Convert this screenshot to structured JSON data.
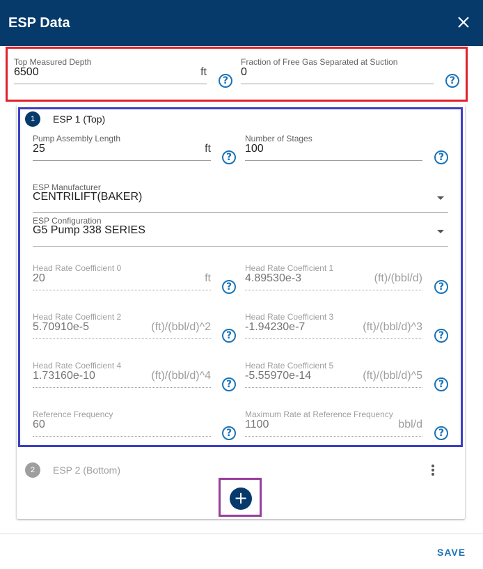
{
  "dialog": {
    "title": "ESP Data",
    "close_icon": "close-icon",
    "save_label": "SAVE"
  },
  "top": {
    "depth": {
      "label": "Top Measured Depth",
      "value": "6500",
      "unit": "ft"
    },
    "gas": {
      "label": "Fraction of Free Gas Separated at Suction",
      "value": "0"
    }
  },
  "esp1": {
    "step": "1",
    "title": "ESP 1 (Top)",
    "pump_length": {
      "label": "Pump Assembly Length",
      "value": "25",
      "unit": "ft"
    },
    "stages": {
      "label": "Number of Stages",
      "value": "100"
    },
    "manufacturer": {
      "label": "ESP Manufacturer",
      "value": "CENTRILIFT(BAKER)"
    },
    "configuration": {
      "label": "ESP Configuration",
      "value": "G5 Pump 338 SERIES"
    },
    "hrc0": {
      "label": "Head Rate Coefficient 0",
      "value": "20",
      "unit": "ft"
    },
    "hrc1": {
      "label": "Head Rate Coefficient 1",
      "value": "4.89530e-3",
      "unit": "(ft)/(bbl/d)"
    },
    "hrc2": {
      "label": "Head Rate Coefficient 2",
      "value": "5.70910e-5",
      "unit": "(ft)/(bbl/d)^2"
    },
    "hrc3": {
      "label": "Head Rate Coefficient 3",
      "value": "-1.94230e-7",
      "unit": "(ft)/(bbl/d)^3"
    },
    "hrc4": {
      "label": "Head Rate Coefficient 4",
      "value": "1.73160e-10",
      "unit": "(ft)/(bbl/d)^4"
    },
    "hrc5": {
      "label": "Head Rate Coefficient 5",
      "value": "-5.55970e-14",
      "unit": "(ft)/(bbl/d)^5"
    },
    "ref_freq": {
      "label": "Reference Frequency",
      "value": "60"
    },
    "max_rate": {
      "label": "Maximum Rate at Reference Frequency",
      "value": "1100",
      "unit": "bbl/d"
    }
  },
  "esp2": {
    "step": "2",
    "title": "ESP 2 (Bottom)"
  },
  "help_glyph": "?",
  "add_glyph": "+",
  "colors": {
    "header": "#053a6b",
    "accent": "#1a73b8",
    "highlight_red": "#e0202a",
    "highlight_blue": "#3b3fc4",
    "highlight_purple": "#9a3d9c"
  }
}
